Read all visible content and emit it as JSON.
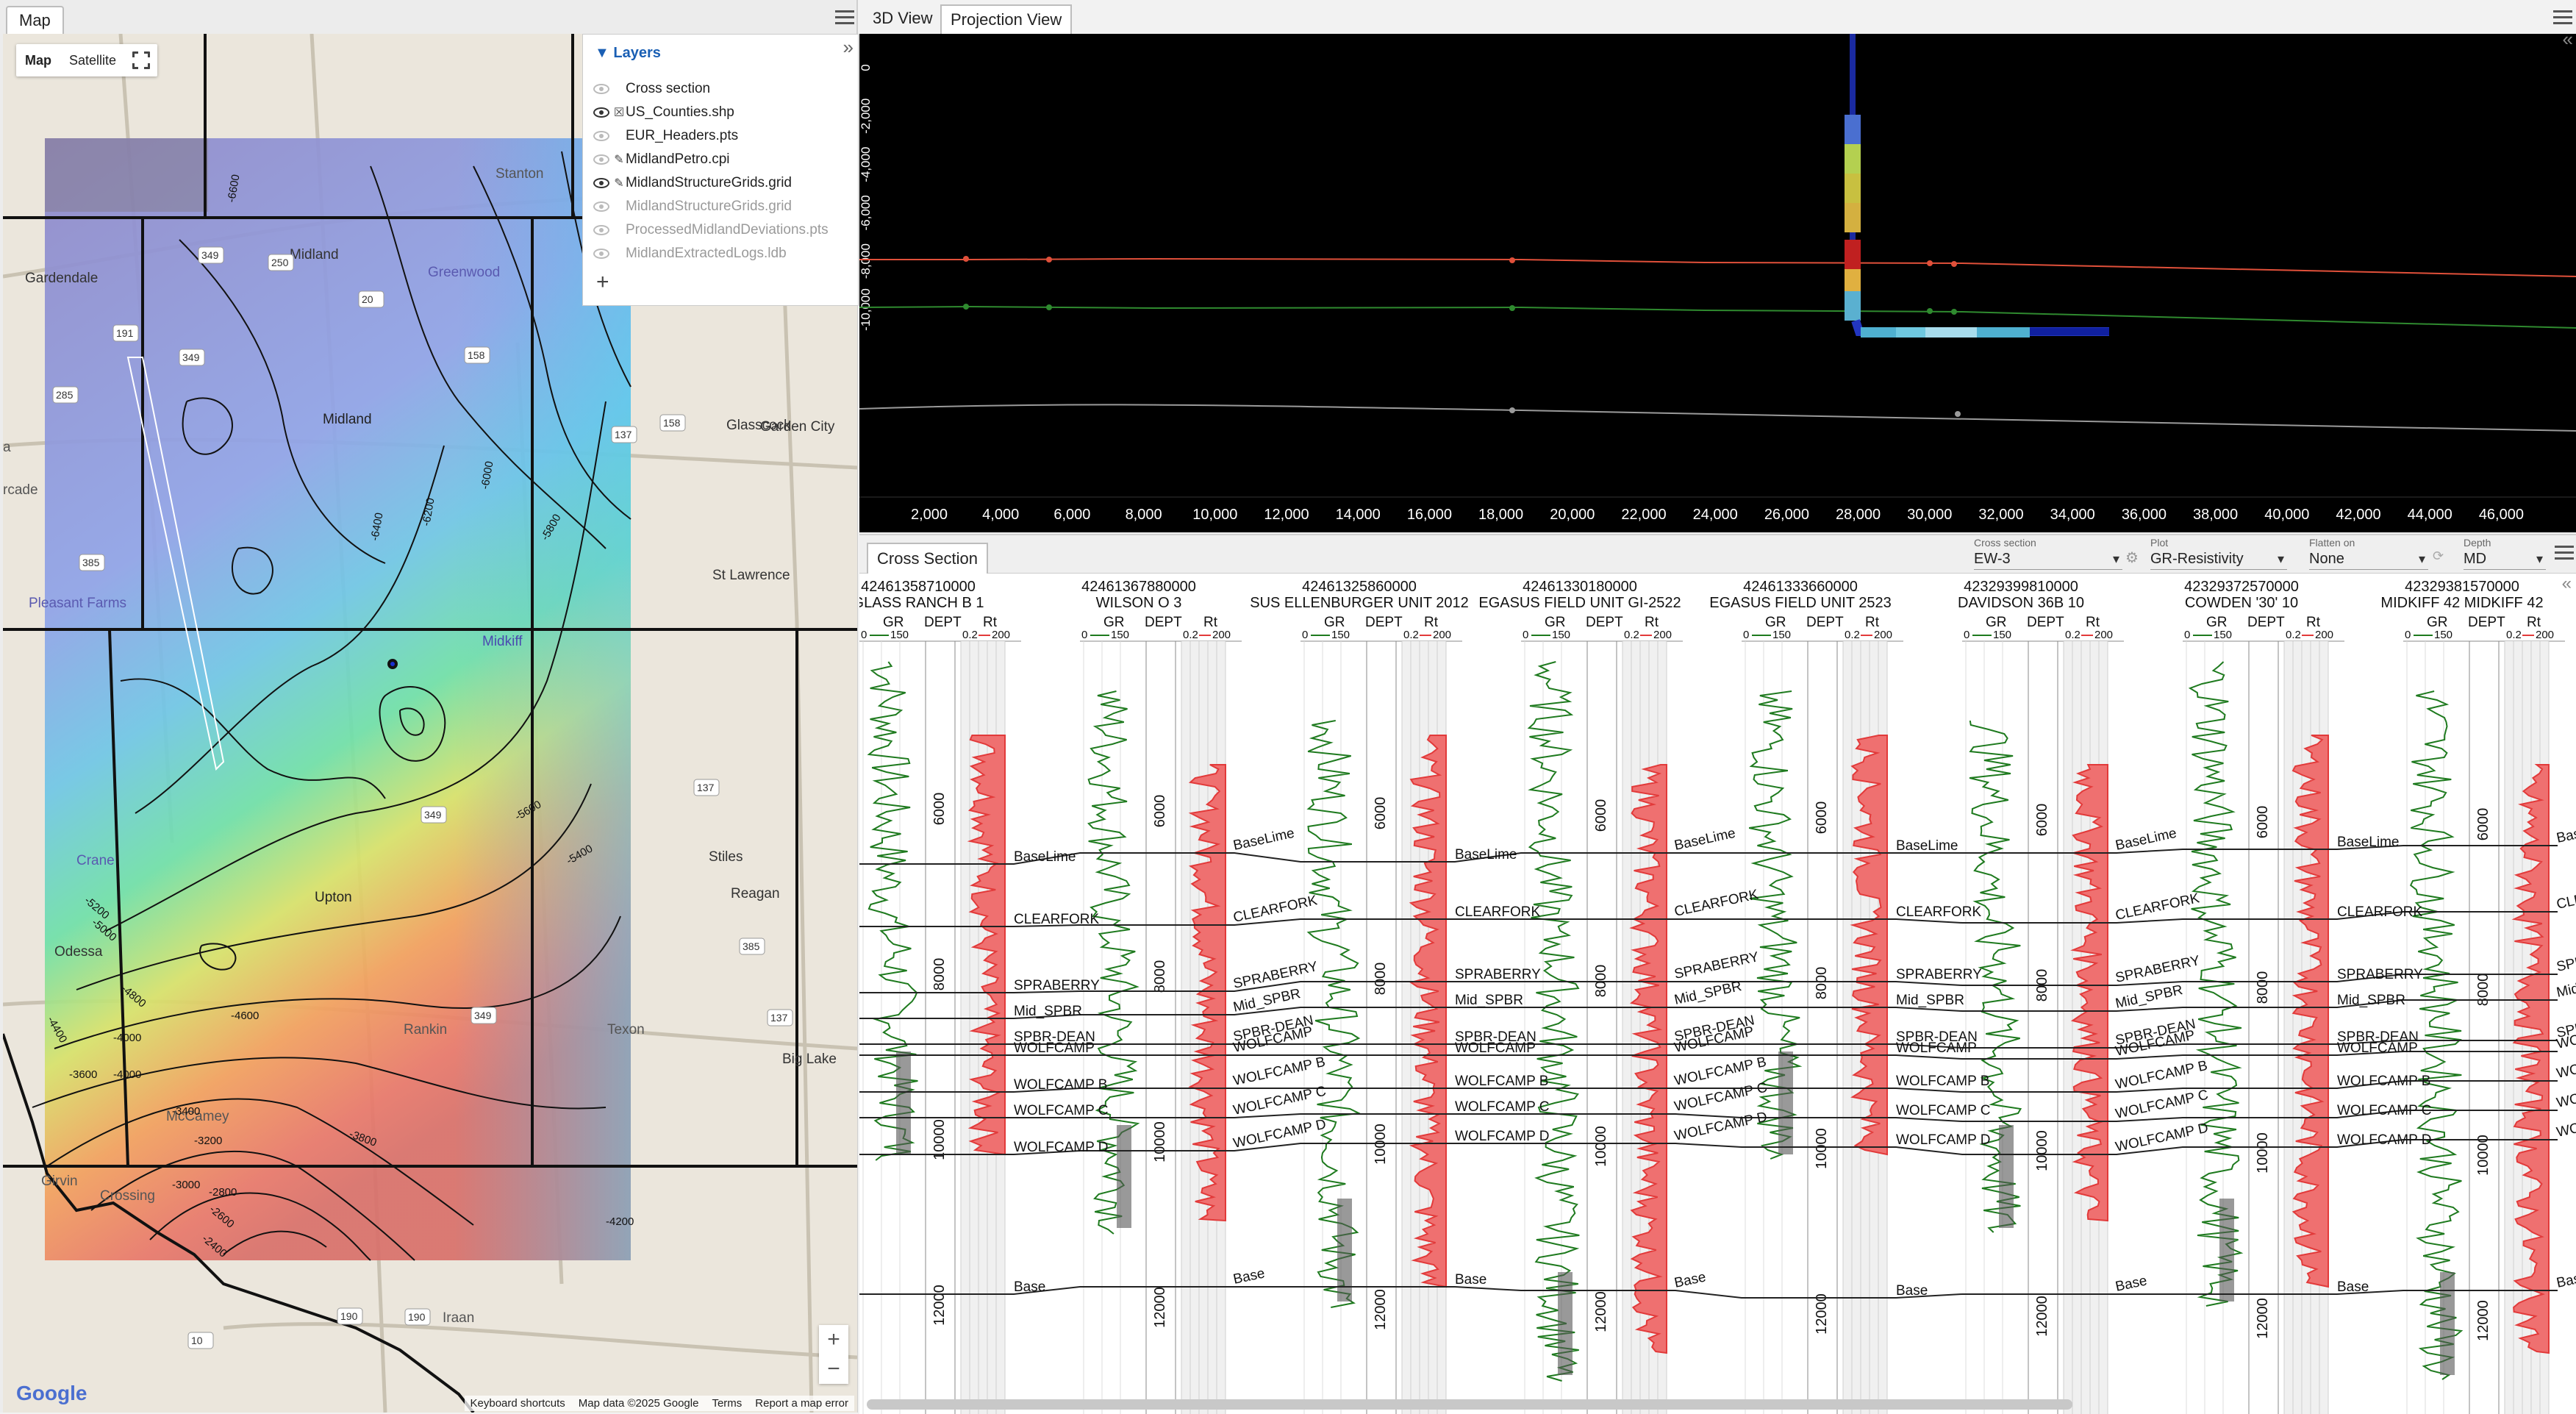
{
  "map_panel": {
    "tab_label": "Map",
    "map_type": {
      "map": "Map",
      "satellite": "Satellite"
    },
    "layers": {
      "title": "Layers",
      "items": [
        {
          "label": "Cross section",
          "visible": false,
          "glyph": ""
        },
        {
          "label": "US_Counties.shp",
          "visible": true,
          "glyph": "☒"
        },
        {
          "label": "EUR_Headers.pts",
          "visible": false,
          "glyph": ""
        },
        {
          "label": "MidlandPetro.cpi",
          "visible": false,
          "glyph": "✎"
        },
        {
          "label": "MidlandStructureGrids.grid",
          "visible": true,
          "glyph": "✎"
        },
        {
          "label": "MidlandStructureGrids.grid",
          "visible": false,
          "glyph": "",
          "dim": true
        },
        {
          "label": "ProcessedMidlandDeviations.pts",
          "visible": false,
          "glyph": "",
          "dim": true
        },
        {
          "label": "MidlandExtractedLogs.ldb",
          "visible": false,
          "glyph": "",
          "dim": true
        }
      ],
      "add": "+"
    },
    "places": [
      {
        "name": "Stanton"
      },
      {
        "name": "Gardendale"
      },
      {
        "name": "Midland"
      },
      {
        "name": "Greenwood"
      },
      {
        "name": "Odessa"
      },
      {
        "name": "Midland"
      },
      {
        "name": "Glasscock"
      },
      {
        "name": "Garden City"
      },
      {
        "name": "Pleasant Farms"
      },
      {
        "name": "St Lawrence"
      },
      {
        "name": "Midkiff"
      },
      {
        "name": "Crane"
      },
      {
        "name": "Upton"
      },
      {
        "name": "Stiles"
      },
      {
        "name": "Reagan"
      },
      {
        "name": "Rankin"
      },
      {
        "name": "Texon"
      },
      {
        "name": "Big Lake"
      },
      {
        "name": "McCamey"
      },
      {
        "name": "Girvin"
      },
      {
        "name": "Crossing"
      },
      {
        "name": "Iraan"
      },
      {
        "name": "rcade"
      },
      {
        "name": "a"
      }
    ],
    "contour_labels": [
      "-6600",
      "-6400",
      "-6200",
      "-6000",
      "-5800",
      "-5600",
      "-5400",
      "-5200",
      "-5000",
      "-4800",
      "-4600",
      "-4400",
      "-4000",
      "-3600",
      "-3400",
      "-3200",
      "-3000",
      "-2800",
      "-2600",
      "-2400",
      "-4200",
      "-4000",
      "-3800"
    ],
    "highway_labels": [
      "349",
      "250",
      "20",
      "191",
      "349",
      "158",
      "285",
      "385",
      "158",
      "137",
      "349",
      "137",
      "137",
      "385",
      "190",
      "190",
      "10",
      "349"
    ],
    "footer": {
      "shortcuts": "Keyboard shortcuts",
      "data": "Map data ©2025 Google",
      "terms": "Terms",
      "report": "Report a map error"
    },
    "logo": "Google",
    "zoom_in": "+",
    "zoom_out": "−"
  },
  "projection_panel": {
    "tabs": [
      "3D View",
      "Projection View"
    ],
    "active_tab": "Projection View",
    "y_ticks": [
      "0",
      "-2,000",
      "-4,000",
      "-6,000",
      "-8,000",
      "-10,000"
    ],
    "x_ticks": [
      "2,000",
      "4,000",
      "6,000",
      "8,000",
      "10,000",
      "12,000",
      "14,000",
      "16,000",
      "18,000",
      "20,000",
      "22,000",
      "24,000",
      "26,000",
      "28,000",
      "30,000",
      "32,000",
      "34,000",
      "36,000",
      "38,000",
      "40,000",
      "42,000",
      "44,000",
      "46,000"
    ],
    "horizon_colors": [
      "#e0503a",
      "#2f8a2f",
      "#9a9a9a"
    ]
  },
  "cross_section": {
    "tab_label": "Cross Section",
    "controls": {
      "cross_section": {
        "label": "Cross section",
        "value": "EW-3"
      },
      "plot": {
        "label": "Plot",
        "value": "GR-Resistivity"
      },
      "flatten": {
        "label": "Flatten on",
        "value": "None"
      },
      "depth": {
        "label": "Depth",
        "value": "MD"
      }
    },
    "track_headers": {
      "gr": "GR",
      "dept": "DEPT",
      "rt": "Rt",
      "gr_min": "0",
      "gr_max": "150",
      "rt_min": "0.2",
      "rt_max": "200"
    },
    "wells": [
      {
        "uwi": "42461358710000",
        "name": "GLASS RANCH B 1"
      },
      {
        "uwi": "42461367880000",
        "name": "WILSON O 3"
      },
      {
        "uwi": "42461325860000",
        "name": "SUS ELLENBURGER UNIT 2012"
      },
      {
        "uwi": "42461330180000",
        "name": "EGASUS FIELD UNIT GI-2522"
      },
      {
        "uwi": "42461333660000",
        "name": "EGASUS FIELD UNIT 2523"
      },
      {
        "uwi": "42329399810000",
        "name": "DAVIDSON 36B 10"
      },
      {
        "uwi": "42329372570000",
        "name": "COWDEN '30' 10"
      },
      {
        "uwi": "42329381570000",
        "name": "MIDKIFF 42 MIDKIFF 42"
      }
    ],
    "depth_labels": [
      "6000",
      "8000",
      "10000",
      "12000"
    ],
    "tops": [
      "BaseLime",
      "CLEARFORK",
      "SPRABERRY",
      "Mid_SPBR",
      "SPBR-DEAN",
      "WOLFCAMP",
      "WOLFCAMP B",
      "WOLFCAMP C",
      "WOLFCAMP D",
      "Base"
    ],
    "colors": {
      "gr": "#1e7a1e",
      "rt": "#e23a3a",
      "rt_fill": "#ef7070",
      "gr_fill": "#555555"
    }
  }
}
